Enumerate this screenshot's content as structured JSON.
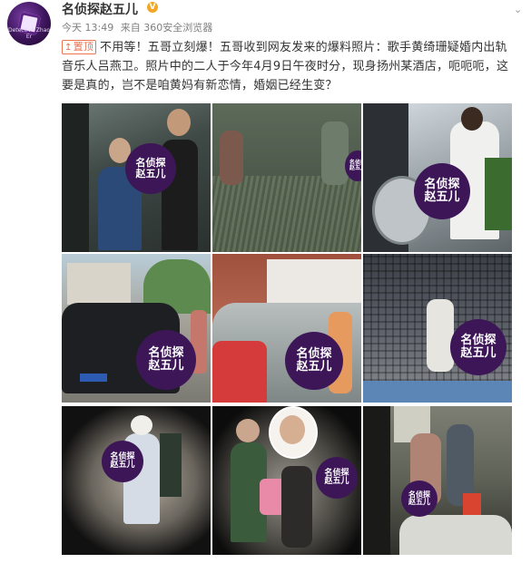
{
  "user": {
    "name": "名侦探赵五儿",
    "avatar_text": "Detective Zhao Er",
    "verified": "V"
  },
  "meta": {
    "time": "今天 13:49",
    "source": "来自 360安全浏览器"
  },
  "post": {
    "pin_label": "置顶",
    "text": "不用等！五哥立刻爆！五哥收到网友发来的爆料照片：歌手黄绮珊疑婚内出轨音乐人吕燕卫。照片中的二人于今年4月9日午夜时分，现身扬州某酒店，呃呃呃，这要是真的，岂不是咱黄妈有新恋情，婚姻已经生变？"
  },
  "watermark": {
    "line1": "名侦探",
    "line2": "赵五儿"
  },
  "photos": [
    {
      "label": "photo-1"
    },
    {
      "label": "photo-2"
    },
    {
      "label": "photo-3"
    },
    {
      "label": "photo-4"
    },
    {
      "label": "photo-5"
    },
    {
      "label": "photo-6"
    },
    {
      "label": "photo-7"
    },
    {
      "label": "photo-8"
    },
    {
      "label": "photo-9"
    }
  ],
  "colors": {
    "pin": "#eb7350",
    "watermark": "#3d1658"
  }
}
